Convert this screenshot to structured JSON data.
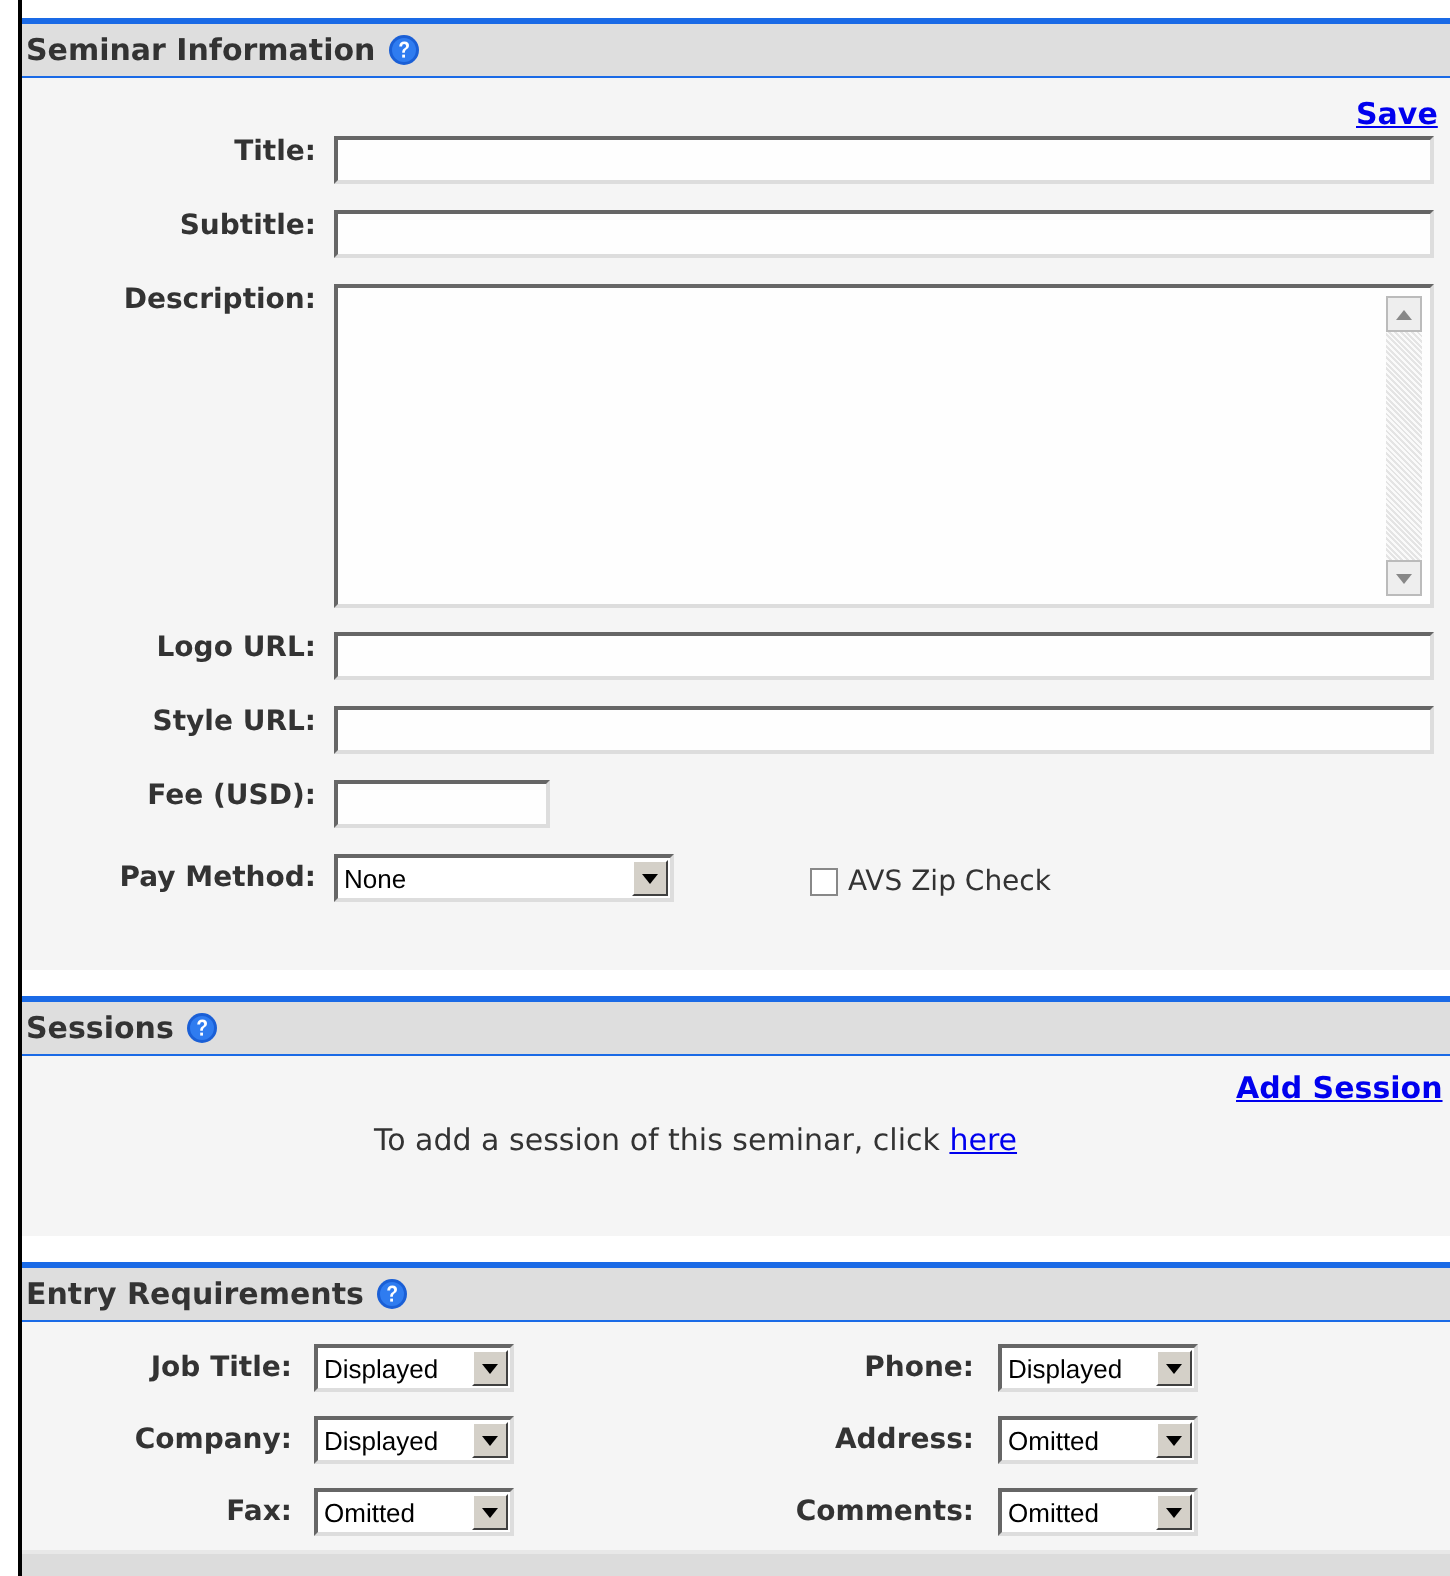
{
  "seminar_information": {
    "title": "Seminar Information",
    "save_link": "Save",
    "fields": [
      {
        "kind": "text",
        "label": "Title:"
      },
      {
        "kind": "text",
        "label": "Subtitle:"
      },
      {
        "kind": "textarea",
        "label": "Description:"
      },
      {
        "kind": "text",
        "label": "Logo URL:"
      },
      {
        "kind": "text",
        "label": "Style URL:"
      },
      {
        "kind": "short",
        "label": "Fee (USD):"
      }
    ],
    "pay_method": {
      "label": "Pay Method:",
      "value": "None"
    },
    "avs_zip_check": {
      "label": "AVS Zip Check",
      "checked": false
    }
  },
  "sessions": {
    "title": "Sessions",
    "add_link": "Add Session",
    "message": "To add a session of this seminar, click",
    "message_link": "here"
  },
  "entry_requirements": {
    "title": "Entry Requirements",
    "rows": [
      [
        {
          "label": "Job Title:",
          "value": "Displayed"
        },
        {
          "label": "Phone:",
          "value": "Displayed"
        }
      ],
      [
        {
          "label": "Company:",
          "value": "Displayed"
        },
        {
          "label": "Address:",
          "value": "Omitted"
        }
      ],
      [
        {
          "label": "Fax:",
          "value": "Omitted"
        },
        {
          "label": "Comments:",
          "value": "Omitted"
        }
      ]
    ]
  }
}
